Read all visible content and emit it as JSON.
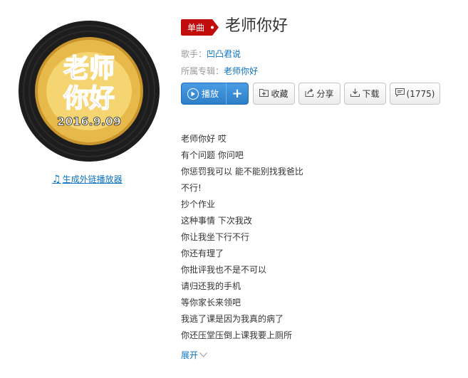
{
  "cover": {
    "line1": "老师",
    "line2": "你好",
    "date": "2016.9.09"
  },
  "outchain_label": "生成外链播放器",
  "badge_label": "单曲",
  "song_title": "老师你好",
  "meta": {
    "artist_label": "歌手：",
    "artist_name": "凹凸君说",
    "album_label": "所属专辑：",
    "album_name": "老师你好"
  },
  "buttons": {
    "play": "播放",
    "add": "+",
    "favorite": "收藏",
    "share": "分享",
    "download": "下载",
    "comment_count": "(1775)"
  },
  "lyrics": [
    "老师你好 哎",
    "有个问题 你问吧",
    "你惩罚我可以 能不能别找我爸比",
    "不行!",
    "抄个作业",
    "这种事情 下次我改",
    "你让我坐下行不行",
    "你还有理了",
    "你批评我也不是不可以",
    "请归还我的手机",
    "等你家长来领吧",
    "我逃了课是因为我真的病了",
    "你还压堂压倒上课我要上厕所"
  ],
  "expand_label": "展开",
  "colors": {
    "accent_blue": "#0c73c2",
    "badge_red": "#c10d0c"
  }
}
